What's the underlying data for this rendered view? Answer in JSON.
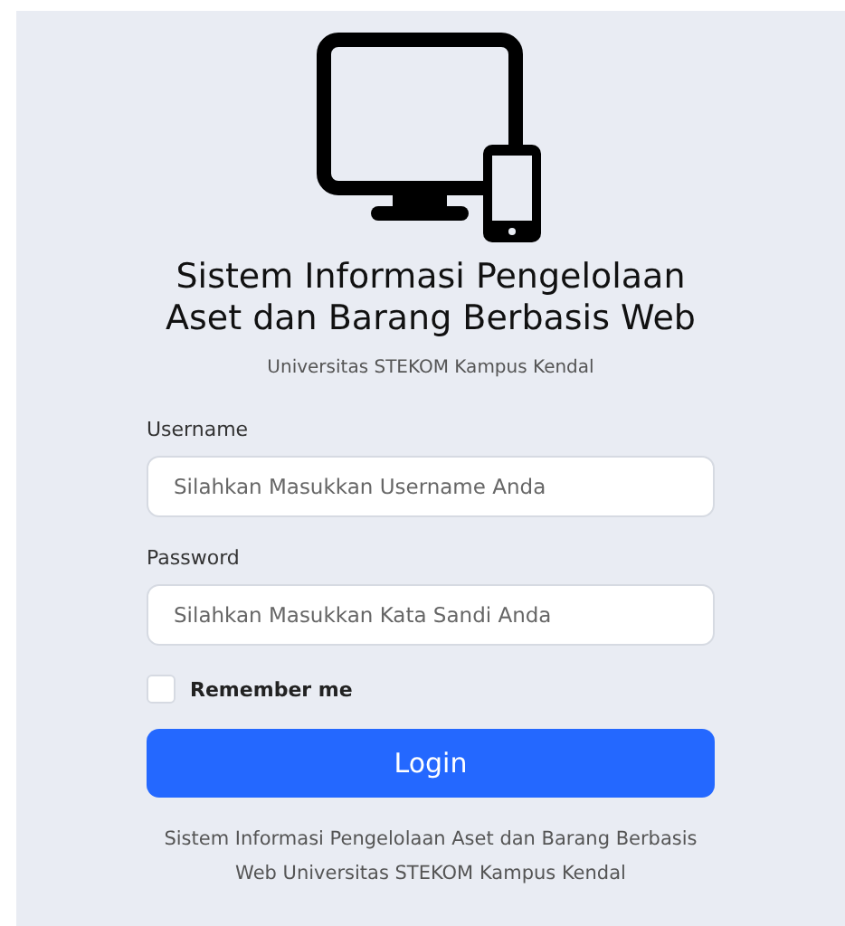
{
  "title": "Sistem Informasi Pengelolaan Aset dan Barang Berbasis Web",
  "subtitle": "Universitas STEKOM Kampus Kendal",
  "fields": [
    {
      "label": "Username",
      "placeholder": "Silahkan Masukkan Username Anda"
    },
    {
      "label": "Password",
      "placeholder": "Silahkan Masukkan Kata Sandi Anda"
    }
  ],
  "remember": {
    "label": "Remember me",
    "checked": false
  },
  "login_button": "Login",
  "footer": "Sistem Informasi Pengelolaan Aset dan Barang Berbasis Web Universitas STEKOM Kampus Kendal"
}
